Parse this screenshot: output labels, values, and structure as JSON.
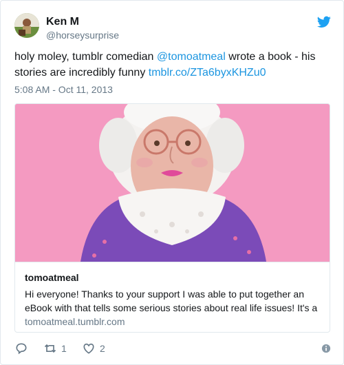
{
  "user": {
    "name": "Ken M",
    "handle": "@horseysurprise"
  },
  "tweet": {
    "text_before": "holy moley, tumblr comedian ",
    "mention": "@tomoatmeal",
    "text_after": " wrote a book - his stories are incredibly funny ",
    "link": "tmblr.co/ZTa6byxKHZu0",
    "timestamp": "5:08 AM - Oct 11, 2013"
  },
  "card": {
    "title": "tomoatmeal",
    "description": "Hi everyone! Thanks to your support I was able to put together an eBook with that tells some serious stories about real life issues! It's a",
    "domain": "tomoatmeal.tumblr.com"
  },
  "actions": {
    "reply_count": "",
    "retweet_count": "1",
    "like_count": "2"
  },
  "icons": {
    "bird": "twitter-bird-icon",
    "reply": "reply-icon",
    "retweet": "retweet-icon",
    "like": "heart-icon",
    "info": "info-icon"
  },
  "colors": {
    "accent": "#1da1f2",
    "link": "#1b95e0",
    "secondary_text": "#657786",
    "card_image_bg": "#f49ac1"
  }
}
